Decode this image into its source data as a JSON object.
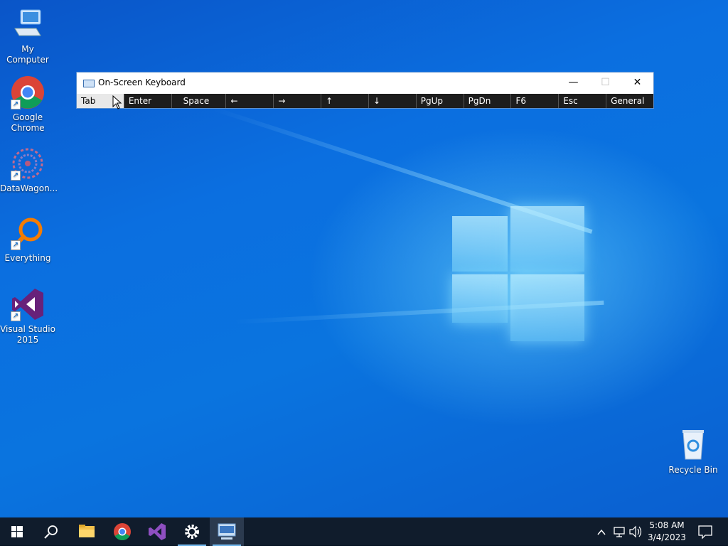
{
  "desktop_icons": [
    {
      "label": "My Computer"
    },
    {
      "label": "Google Chrome"
    },
    {
      "label": "DataWagon..."
    },
    {
      "label": "Everything"
    },
    {
      "label": "Visual Studio 2015"
    },
    {
      "label": "Recycle Bin"
    }
  ],
  "osk": {
    "title": "On-Screen Keyboard",
    "minimize": "—",
    "maximize": "☐",
    "close": "✕",
    "keys": [
      "Tab",
      "Enter",
      "Space",
      "←",
      "→",
      "↑",
      "↓",
      "PgUp",
      "PgDn",
      "F6",
      "Esc",
      "General"
    ]
  },
  "taskbar": {
    "time": "5:08 AM",
    "date": "3/4/2023",
    "icons": [
      "windows-start-icon",
      "search-icon",
      "file-explorer-icon",
      "chrome-icon",
      "visual-studio-icon",
      "settings-gear-icon",
      "on-screen-keyboard-icon"
    ]
  },
  "colors": {
    "taskbar": "#101c2c",
    "desktop": "#0a6fe0",
    "accent": "#76b9ed"
  }
}
